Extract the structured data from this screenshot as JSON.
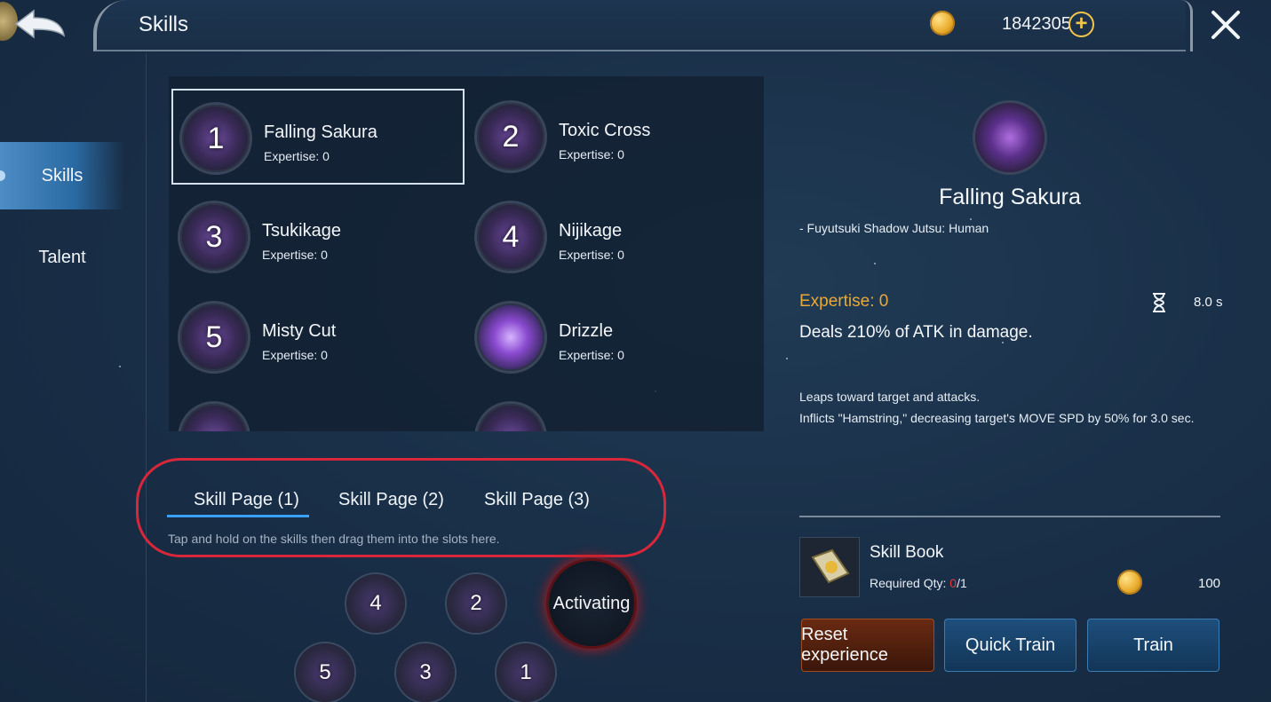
{
  "header": {
    "title": "Skills",
    "gold_amount": "1842305",
    "gold_icon": "gold-coin-icon",
    "plus_icon": "plus-icon",
    "close_icon": "close-icon",
    "back_icon": "back-arrow-icon"
  },
  "nav": {
    "items": [
      {
        "label": "Skills",
        "active": true
      },
      {
        "label": "Talent",
        "active": false
      }
    ]
  },
  "skills": [
    {
      "number": "1",
      "name": "Falling Sakura",
      "expertise": "Expertise: 0",
      "selected": true
    },
    {
      "number": "2",
      "name": "Toxic Cross",
      "expertise": "Expertise: 0",
      "selected": false
    },
    {
      "number": "3",
      "name": "Tsukikage",
      "expertise": "Expertise: 0",
      "selected": false
    },
    {
      "number": "4",
      "name": "Nijikage",
      "expertise": "Expertise: 0",
      "selected": false
    },
    {
      "number": "5",
      "name": "Misty Cut",
      "expertise": "Expertise: 0",
      "selected": false
    },
    {
      "number": "",
      "name": "Drizzle",
      "expertise": "Expertise: 0",
      "selected": false
    }
  ],
  "skill_pages": {
    "tabs": [
      {
        "label": "Skill Page (1)",
        "active": true
      },
      {
        "label": "Skill Page (2)",
        "active": false
      },
      {
        "label": "Skill Page (3)",
        "active": false
      }
    ],
    "hint": "Tap and hold on the skills then drag them into the slots here."
  },
  "slots": {
    "top_row": [
      "4",
      "2"
    ],
    "bottom_row": [
      "5",
      "3",
      "1"
    ],
    "activating_label": "Activating"
  },
  "detail": {
    "name": "Falling Sakura",
    "subtitle": "- Fuyutsuki Shadow Jutsu: Human",
    "expertise": "Expertise: 0",
    "cooldown": "8.0 s",
    "damage": "Deals 210% of ATK in damage.",
    "desc_line1": "Leaps toward target and attacks.",
    "desc_line2": "Inflicts \"Hamstring,\" decreasing target's MOVE SPD by 50% for 3.0 sec."
  },
  "book": {
    "name": "Skill Book",
    "required_label": "Required Qty: ",
    "have": "0",
    "need": "/1",
    "cost": "100"
  },
  "buttons": {
    "reset": "Reset experience",
    "quick_train": "Quick Train",
    "train": "Train"
  },
  "colors": {
    "accent_blue": "#3aa1ff",
    "expertise_orange": "#e8a93a",
    "highlight_red": "#d8273a"
  }
}
